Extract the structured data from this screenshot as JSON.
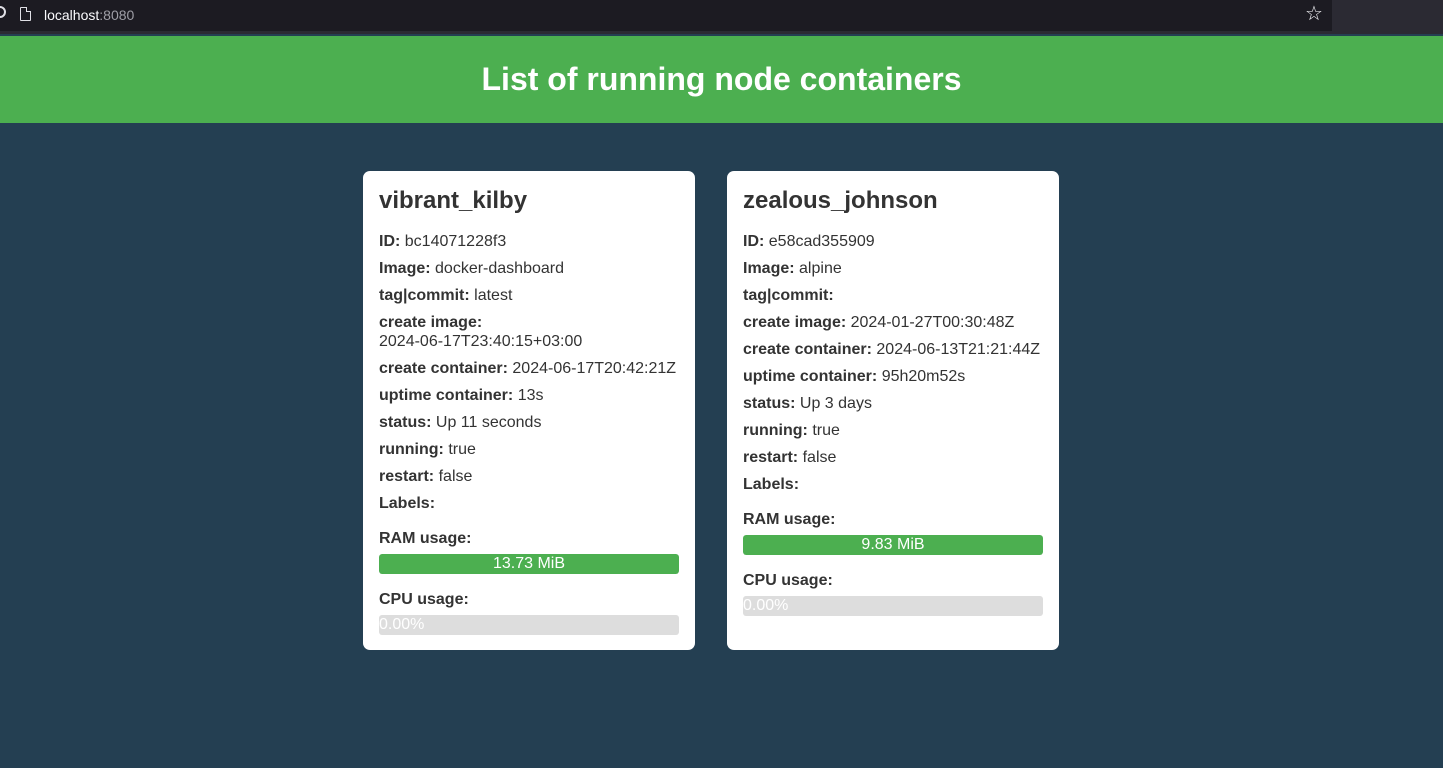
{
  "browser": {
    "url_host": "localhost",
    "url_port": ":8080"
  },
  "header": {
    "title": "List of running node containers"
  },
  "containers": [
    {
      "name": "vibrant_kilby",
      "fields": [
        {
          "label": "ID:",
          "value": "bc14071228f3"
        },
        {
          "label": "Image:",
          "value": "docker-dashboard"
        },
        {
          "label": "tag|commit:",
          "value": "latest"
        },
        {
          "label": "create image:",
          "value": "2024-06-17T23:40:15+03:00"
        },
        {
          "label": "create container:",
          "value": "2024-06-17T20:42:21Z"
        },
        {
          "label": "uptime container:",
          "value": "13s"
        },
        {
          "label": "status:",
          "value": "Up 11 seconds"
        },
        {
          "label": "running:",
          "value": "true"
        },
        {
          "label": "restart:",
          "value": "false"
        },
        {
          "label": "Labels:",
          "value": ""
        }
      ],
      "ram_label": "RAM usage:",
      "ram_text": "13.73 MiB",
      "ram_fraction": 1.0,
      "cpu_label": "CPU usage:",
      "cpu_text": "0.00%",
      "cpu_fraction": 0.0
    },
    {
      "name": "zealous_johnson",
      "fields": [
        {
          "label": "ID:",
          "value": "e58cad355909"
        },
        {
          "label": "Image:",
          "value": "alpine"
        },
        {
          "label": "tag|commit:",
          "value": ""
        },
        {
          "label": "create image:",
          "value": "2024-01-27T00:30:48Z"
        },
        {
          "label": "create container:",
          "value": "2024-06-13T21:21:44Z"
        },
        {
          "label": "uptime container:",
          "value": "95h20m52s"
        },
        {
          "label": "status:",
          "value": "Up 3 days"
        },
        {
          "label": "running:",
          "value": "true"
        },
        {
          "label": "restart:",
          "value": "false"
        },
        {
          "label": "Labels:",
          "value": ""
        }
      ],
      "ram_label": "RAM usage:",
      "ram_text": "9.83 MiB",
      "ram_fraction": 1.0,
      "cpu_label": "CPU usage:",
      "cpu_text": "0.00%",
      "cpu_fraction": 0.0
    }
  ],
  "colors": {
    "header_bg": "#4caf50",
    "page_bg": "#243f52",
    "bar_fill": "#4caf50",
    "bar_track": "#dddddd"
  }
}
